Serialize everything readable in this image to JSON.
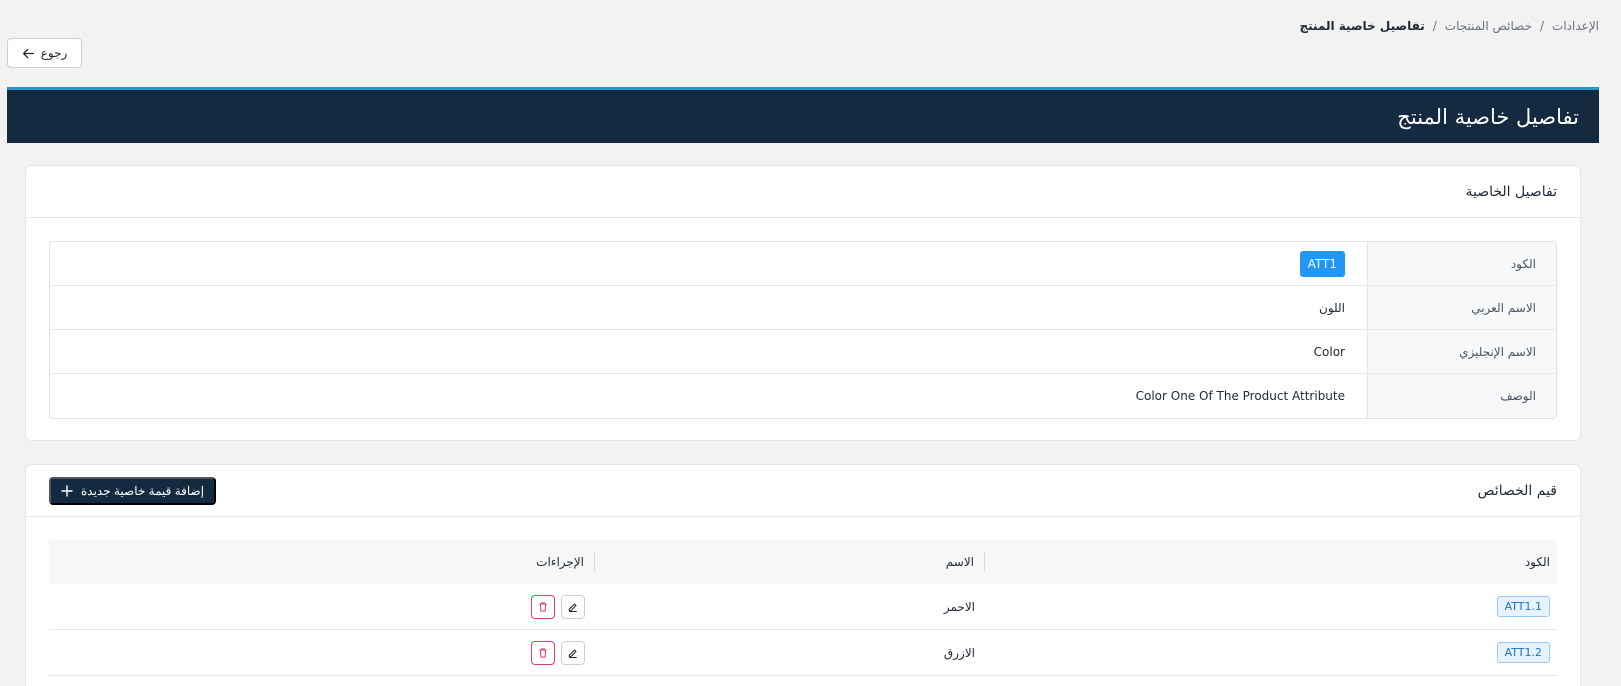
{
  "breadcrumb": {
    "items": [
      "الإعدادات",
      "خصائص المنتجات",
      "تفاصيل خاصية المنتج"
    ],
    "separator": "/"
  },
  "back_button": {
    "label": "رجوع",
    "icon": "arrow-left-icon"
  },
  "header": {
    "title": "تفاصيل خاصية المنتج"
  },
  "details_card": {
    "title": "تفاصيل الخاصية",
    "rows": [
      {
        "label": "الكود",
        "value": "ATT1"
      },
      {
        "label": "الاسم العربي",
        "value": "اللون"
      },
      {
        "label": "الاسم الإنجليزي",
        "value": "Color"
      },
      {
        "label": "الوصف",
        "value": "Color One Of The Product Attribute"
      }
    ]
  },
  "values_card": {
    "title": "قيم الخصائص",
    "add_button": {
      "label": "إضافة قيمة خاصية جديدة",
      "icon": "plus-icon"
    },
    "columns": [
      "الكود",
      "الاسم",
      "الإجراءات"
    ],
    "rows": [
      {
        "code": "ATT1.1",
        "name": "الاحمر"
      },
      {
        "code": "ATT1.2",
        "name": "الازرق"
      }
    ]
  },
  "colors": {
    "header_bg": "#142a40",
    "accent": "#2796c8",
    "badge_primary": "#2196f3",
    "danger": "#e0435a"
  }
}
